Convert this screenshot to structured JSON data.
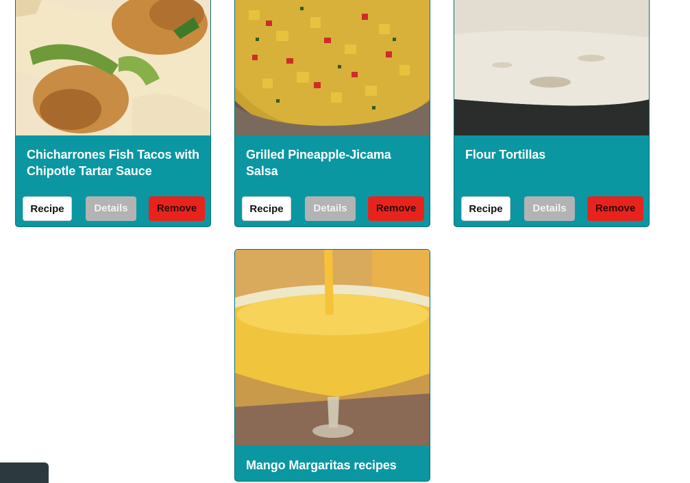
{
  "recipes": [
    {
      "title": "Chicharrones Fish Tacos with Chipotle Tartar Sauce",
      "image": "fish-tacos-image",
      "recipe_label": "Recipe",
      "details_label": "Details",
      "remove_label": "Remove"
    },
    {
      "title": "Grilled Pineapple-Jicama Salsa",
      "image": "pineapple-salsa-image",
      "recipe_label": "Recipe",
      "details_label": "Details",
      "remove_label": "Remove"
    },
    {
      "title": "Flour Tortillas",
      "image": "flour-tortilla-image",
      "recipe_label": "Recipe",
      "details_label": "Details",
      "remove_label": "Remove"
    },
    {
      "title": "Mango Margaritas recipes",
      "image": "mango-margarita-image"
    }
  ],
  "colors": {
    "card_bg": "#0a97a2",
    "remove_button": "#e8231e",
    "details_button": "#b3b3b3",
    "recipe_button": "#ffffff"
  }
}
